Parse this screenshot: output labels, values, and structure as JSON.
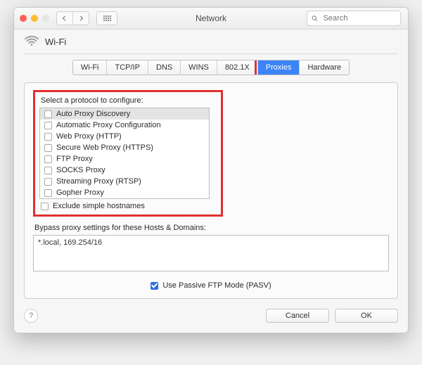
{
  "window": {
    "title": "Network",
    "search_placeholder": "Search"
  },
  "header": {
    "connection_name": "Wi-Fi"
  },
  "tabs": {
    "items": [
      "Wi-Fi",
      "TCP/IP",
      "DNS",
      "WINS",
      "802.1X",
      "Proxies",
      "Hardware"
    ],
    "active_index": 5
  },
  "proxies": {
    "select_label": "Select a protocol to configure:",
    "protocols": [
      {
        "label": "Auto Proxy Discovery",
        "checked": false,
        "selected": true
      },
      {
        "label": "Automatic Proxy Configuration",
        "checked": false,
        "selected": false
      },
      {
        "label": "Web Proxy (HTTP)",
        "checked": false,
        "selected": false
      },
      {
        "label": "Secure Web Proxy (HTTPS)",
        "checked": false,
        "selected": false
      },
      {
        "label": "FTP Proxy",
        "checked": false,
        "selected": false
      },
      {
        "label": "SOCKS Proxy",
        "checked": false,
        "selected": false
      },
      {
        "label": "Streaming Proxy (RTSP)",
        "checked": false,
        "selected": false
      },
      {
        "label": "Gopher Proxy",
        "checked": false,
        "selected": false
      }
    ],
    "exclude_simple": {
      "label": "Exclude simple hostnames",
      "checked": false
    },
    "bypass_label": "Bypass proxy settings for these Hosts & Domains:",
    "bypass_value": "*.local, 169.254/16",
    "passive_ftp": {
      "label": "Use Passive FTP Mode (PASV)",
      "checked": true
    }
  },
  "footer": {
    "cancel": "Cancel",
    "ok": "OK"
  },
  "annotations": {
    "highlight_color": "#e03030",
    "highlighted_tab": "Proxies",
    "highlighted_region": "protocol-configure-area"
  }
}
